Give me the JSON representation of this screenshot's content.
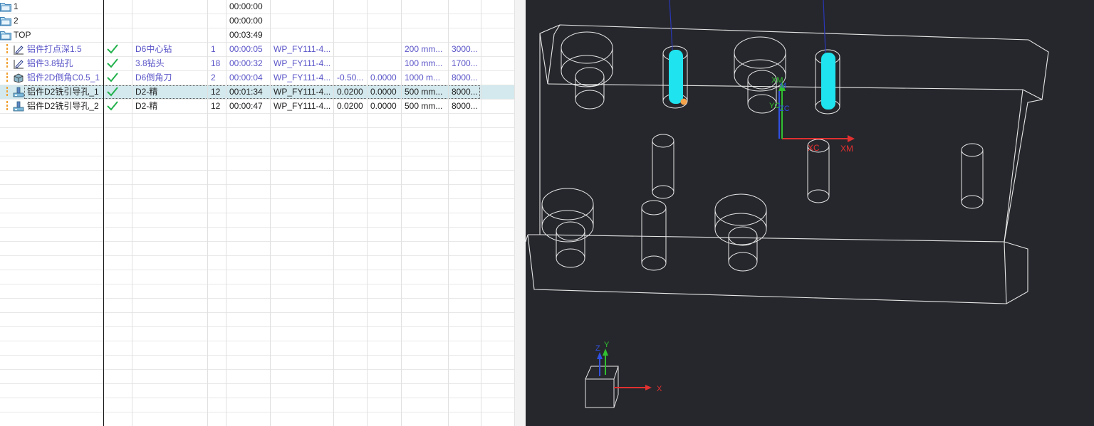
{
  "rows": [
    {
      "type": "folder",
      "name": "1",
      "time": "00:00:00"
    },
    {
      "type": "folder",
      "name": "2",
      "time": "00:00:00"
    },
    {
      "type": "folder",
      "name": "TOP",
      "time": "00:03:49"
    },
    {
      "type": "op",
      "blue": true,
      "icon": "pencil-path-icon",
      "name": "铝件打点深1.5",
      "tool": "D6中心钻",
      "toolno": "1",
      "time": "00:00:05",
      "geom": "WP_FY111-4...",
      "c1": "",
      "c2": "",
      "feed": "200 mm...",
      "speed": "3000..."
    },
    {
      "type": "op",
      "blue": true,
      "icon": "pencil-path-icon",
      "name": "铝件3.8钻孔",
      "tool": "3.8钻头",
      "toolno": "18",
      "time": "00:00:32",
      "geom": "WP_FY111-4...",
      "c1": "",
      "c2": "",
      "feed": "100 mm...",
      "speed": "1700..."
    },
    {
      "type": "op",
      "blue": true,
      "icon": "chamfer-op-icon",
      "name": "铝件2D倒角C0.5_1",
      "tool": "D6倒角刀",
      "toolno": "2",
      "time": "00:00:04",
      "geom": "WP_FY111-4...",
      "c1": "-0.50...",
      "c2": "0.0000",
      "feed": "1000 m...",
      "speed": "8000..."
    },
    {
      "type": "op",
      "blue": false,
      "selected": true,
      "icon": "mill-op-icon",
      "name": "铝件D2铣引导孔_1",
      "tool": "D2-精",
      "toolno": "12",
      "time": "00:01:34",
      "geom": "WP_FY111-4...",
      "c1": "0.0200",
      "c2": "0.0000",
      "feed": "500 mm...",
      "speed": "8000..."
    },
    {
      "type": "op",
      "blue": false,
      "icon": "mill-op-icon",
      "name": "铝件D2铣引导孔_2",
      "tool": "D2-精",
      "toolno": "12",
      "time": "00:00:47",
      "geom": "WP_FY111-4...",
      "c1": "0.0200",
      "c2": "0.0000",
      "feed": "500 mm...",
      "speed": "8000..."
    }
  ],
  "viewport": {
    "labels": {
      "xm": "XM",
      "yc": "YC",
      "zc": "ZC",
      "xc": "XC",
      "xm_axis": "XM",
      "tri_x": "X",
      "tri_y": "Y",
      "tri_z": "Z"
    },
    "colors": {
      "background": "#26272c",
      "wire": "#e6e6e6",
      "tool": "#1fe3ee",
      "x_axis": "#e03030",
      "y_axis": "#30c030",
      "z_axis": "#3050e0"
    }
  }
}
